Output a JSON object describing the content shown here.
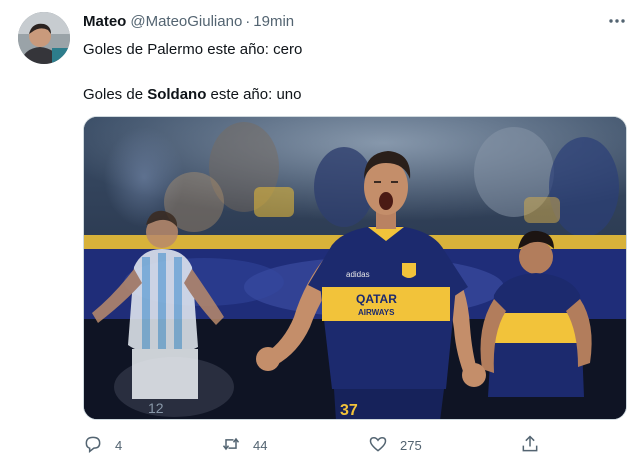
{
  "tweet": {
    "display_name": "Mateo",
    "handle": "@MateoGiuliano",
    "separator": "·",
    "time": "19min",
    "line1": "Goles de Palermo este año: cero",
    "line2_prefix": "Goles de ",
    "line2_bold": "Soldano",
    "line2_suffix": " este año: uno",
    "media": {
      "jersey_sponsor_line1": "QATAR",
      "jersey_sponsor_line2": "AIRWAYS",
      "jersey_brand": "adidas",
      "player_number": "37",
      "opponent_number": "12"
    },
    "counts": {
      "replies": "4",
      "retweets": "44",
      "likes": "275"
    }
  },
  "colors": {
    "text": "#0f1419",
    "secondary": "#536471",
    "boca_blue": "#1c2a6e",
    "boca_gold": "#f2c33a"
  },
  "icons": [
    "more-icon",
    "reply-icon",
    "retweet-icon",
    "like-icon",
    "share-icon"
  ]
}
